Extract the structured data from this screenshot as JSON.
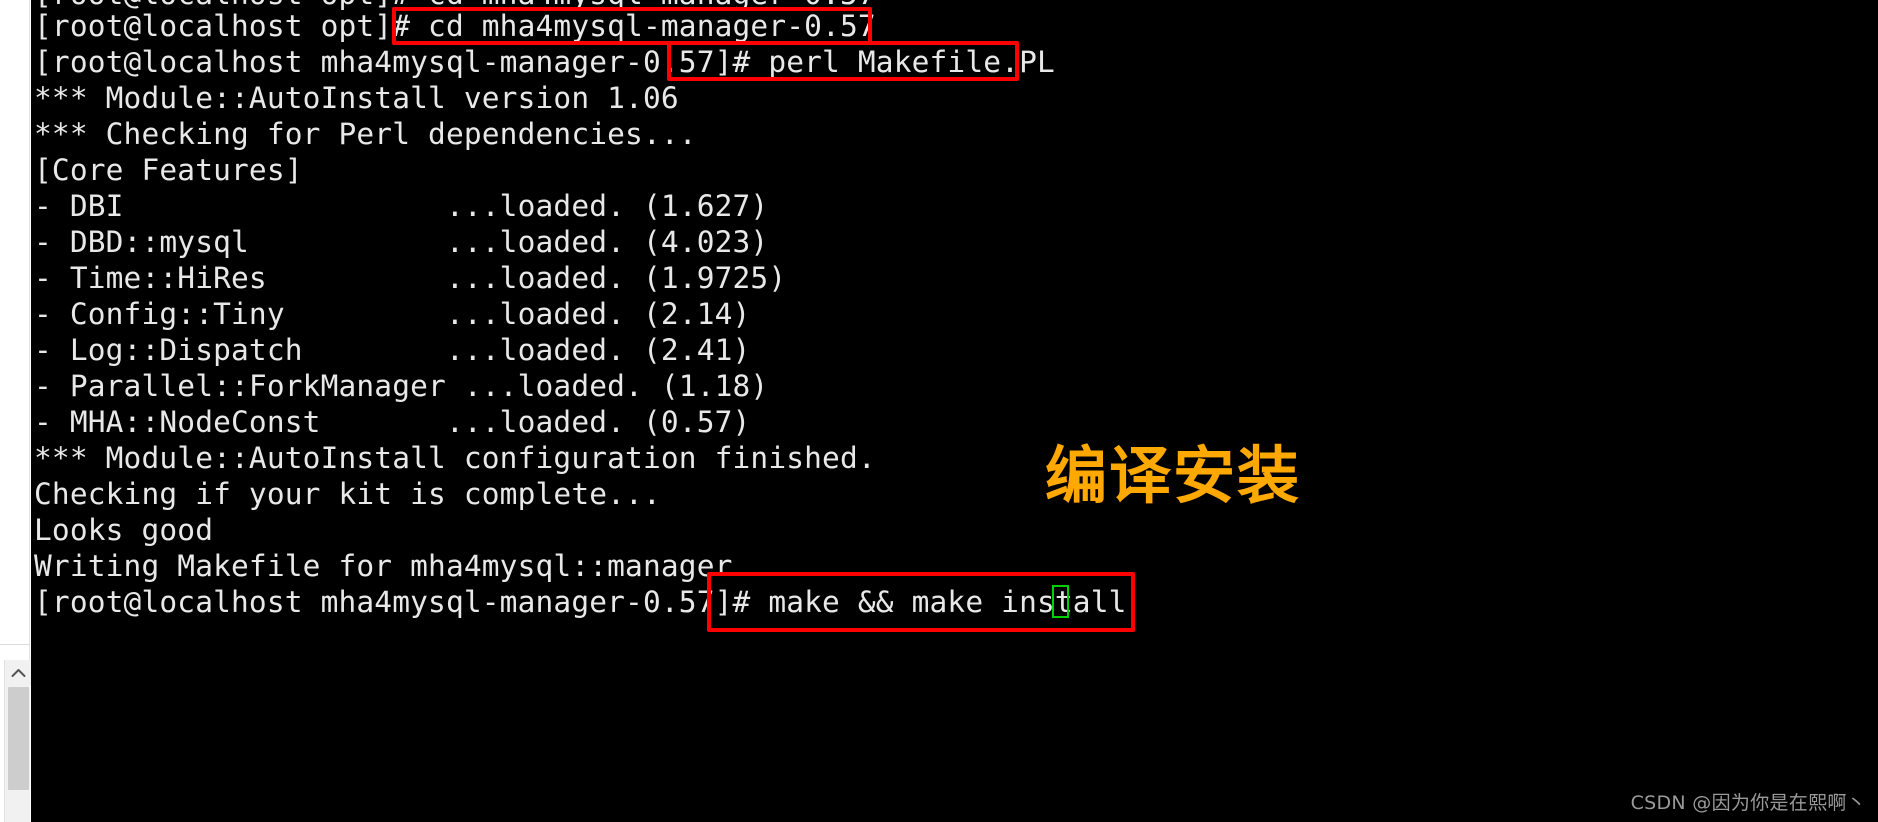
{
  "window": {
    "background_color": "#000000",
    "text_color": "#e8e8e8",
    "gutter_color": "#ffffff"
  },
  "scrollbar": {
    "up_arrow_icon": "chevron-up-icon",
    "thumb_color": "#cdcdcd",
    "track_color": "#f1f1f1"
  },
  "terminal": {
    "prompt_user": "root",
    "prompt_host": "localhost",
    "lines": [
      {
        "id": "l0",
        "text": "[root@localhost opt]# cd mha4mysql-manager-0.57",
        "kind": "prompt"
      },
      {
        "id": "l1",
        "text": "[root@localhost mha4mysql-manager-0.57]# perl Makefile.PL",
        "kind": "prompt"
      },
      {
        "id": "l2",
        "text": "*** Module::AutoInstall version 1.06",
        "kind": "output"
      },
      {
        "id": "l3",
        "text": "*** Checking for Perl dependencies...",
        "kind": "output"
      },
      {
        "id": "l4",
        "text": "[Core Features]",
        "kind": "output"
      },
      {
        "id": "l5",
        "text": "- DBI                  ...loaded. (1.627)",
        "kind": "output"
      },
      {
        "id": "l6",
        "text": "- DBD::mysql           ...loaded. (4.023)",
        "kind": "output"
      },
      {
        "id": "l7",
        "text": "- Time::HiRes          ...loaded. (1.9725)",
        "kind": "output"
      },
      {
        "id": "l8",
        "text": "- Config::Tiny         ...loaded. (2.14)",
        "kind": "output"
      },
      {
        "id": "l9",
        "text": "- Log::Dispatch        ...loaded. (2.41)",
        "kind": "output"
      },
      {
        "id": "l10",
        "text": "- Parallel::ForkManager ...loaded. (1.18)",
        "kind": "output"
      },
      {
        "id": "l11",
        "text": "- MHA::NodeConst       ...loaded. (0.57)",
        "kind": "output"
      },
      {
        "id": "l12",
        "text": "*** Module::AutoInstall configuration finished.",
        "kind": "output"
      },
      {
        "id": "l13",
        "text": "Checking if your kit is complete...",
        "kind": "output"
      },
      {
        "id": "l14",
        "text": "Looks good",
        "kind": "output"
      },
      {
        "id": "l15",
        "text": "Writing Makefile for mha4mysql::manager",
        "kind": "output"
      },
      {
        "id": "l16",
        "text": "[root@localhost mha4mysql-manager-0.57]# make && make install",
        "kind": "prompt"
      }
    ],
    "modules": [
      {
        "name": "DBI",
        "status": "...loaded.",
        "version": "1.627"
      },
      {
        "name": "DBD::mysql",
        "status": "...loaded.",
        "version": "4.023"
      },
      {
        "name": "Time::HiRes",
        "status": "...loaded.",
        "version": "1.9725"
      },
      {
        "name": "Config::Tiny",
        "status": "...loaded.",
        "version": "2.14"
      },
      {
        "name": "Log::Dispatch",
        "status": "...loaded.",
        "version": "2.41"
      },
      {
        "name": "Parallel::ForkManager",
        "status": "...loaded.",
        "version": "1.18"
      },
      {
        "name": "MHA::NodeConst",
        "status": "...loaded.",
        "version": "0.57"
      }
    ],
    "commands": [
      "cd mha4mysql-manager-0.57",
      "perl Makefile.PL",
      "make && make install"
    ]
  },
  "annotations": {
    "highlight_color": "#ff0000",
    "note_color": "#ffa800",
    "cursor_color": "#00d000",
    "note_text": "编译安装",
    "boxes": [
      {
        "id": "box-cd",
        "label": "cd mha4mysql-manager-0.57"
      },
      {
        "id": "box-perl",
        "label": "]# perl Makefile.PL"
      },
      {
        "id": "box-make",
        "label": "make && make install"
      }
    ]
  },
  "watermark": {
    "text": "CSDN @因为你是在熙啊丶"
  }
}
